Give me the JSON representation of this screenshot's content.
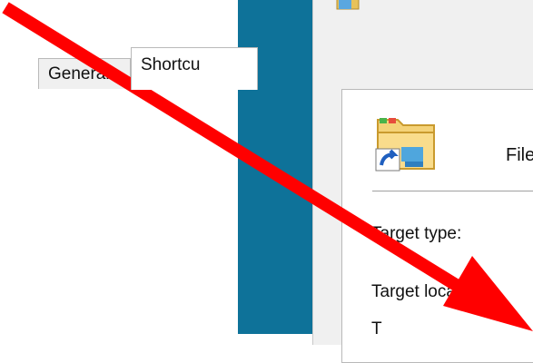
{
  "tabs": [
    {
      "label": "General",
      "active": false
    },
    {
      "label": "Shortcu",
      "active": true
    }
  ],
  "shortcut": {
    "name_partial": "File",
    "fields": {
      "target_type_label": "Target type:",
      "target_location_label": "Target location:",
      "target_label": "T"
    }
  },
  "colors": {
    "desktop": "#0e7299",
    "window_bg": "#f0f0f0",
    "arrow": "#ff0000"
  },
  "icons": [
    "window-title-icon",
    "folder-shortcut-icon",
    "red-arrow-annotation"
  ]
}
